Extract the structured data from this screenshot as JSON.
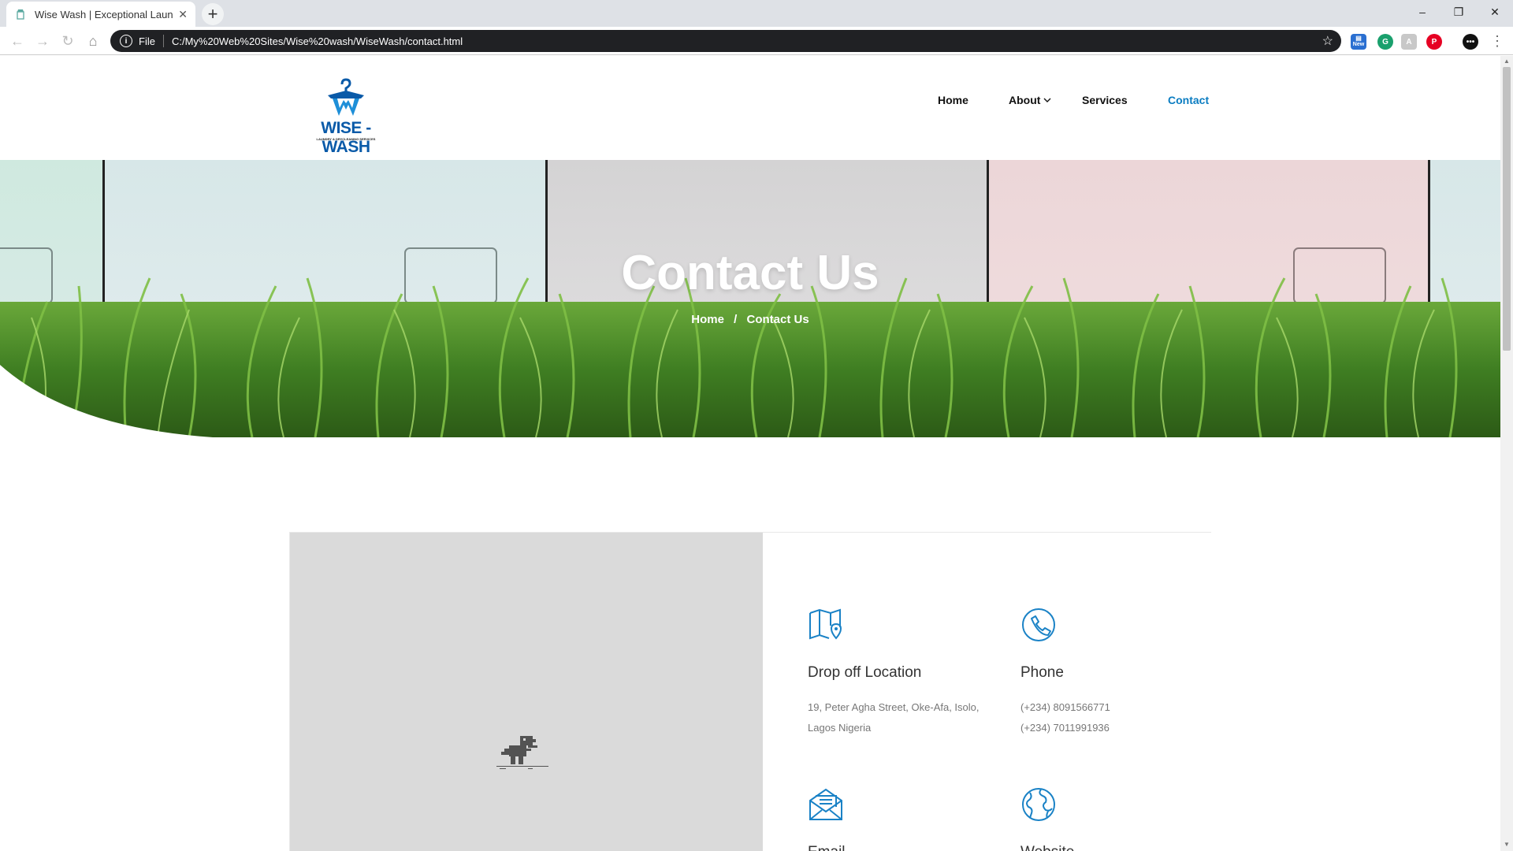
{
  "browser": {
    "tab_title": "Wise Wash | Exceptional Laundry",
    "omnibox_scheme": "File",
    "url": "C:/My%20Web%20Sites/Wise%20wash/WiseWash/contact.html",
    "win_minimize": "–",
    "win_restore": "❐",
    "win_close": "✕",
    "ext_new_label": "New"
  },
  "site": {
    "logo_text": "WISE - WASH",
    "logo_sub": "LAUNDRY & DRYCLEANING SERVICES",
    "nav": {
      "home": "Home",
      "about": "About",
      "services": "Services",
      "contact": "Contact"
    },
    "accent_color": "#0a7cc1"
  },
  "hero": {
    "title": "Contact Us",
    "breadcrumb_home": "Home",
    "breadcrumb_sep": "/",
    "breadcrumb_current": "Contact Us"
  },
  "contact": {
    "location": {
      "title": "Drop off Location",
      "line1": "19, Peter Agha Street, Oke-Afa, Isolo,",
      "line2": "Lagos Nigeria",
      "icon": "map-icon"
    },
    "phone": {
      "title": "Phone",
      "line1": "(+234) 8091566771",
      "line2": "(+234) 7011991936",
      "icon": "phone-icon"
    },
    "email": {
      "title": "Email",
      "icon": "envelope-icon"
    },
    "website": {
      "title": "Website",
      "icon": "globe-icon"
    }
  }
}
